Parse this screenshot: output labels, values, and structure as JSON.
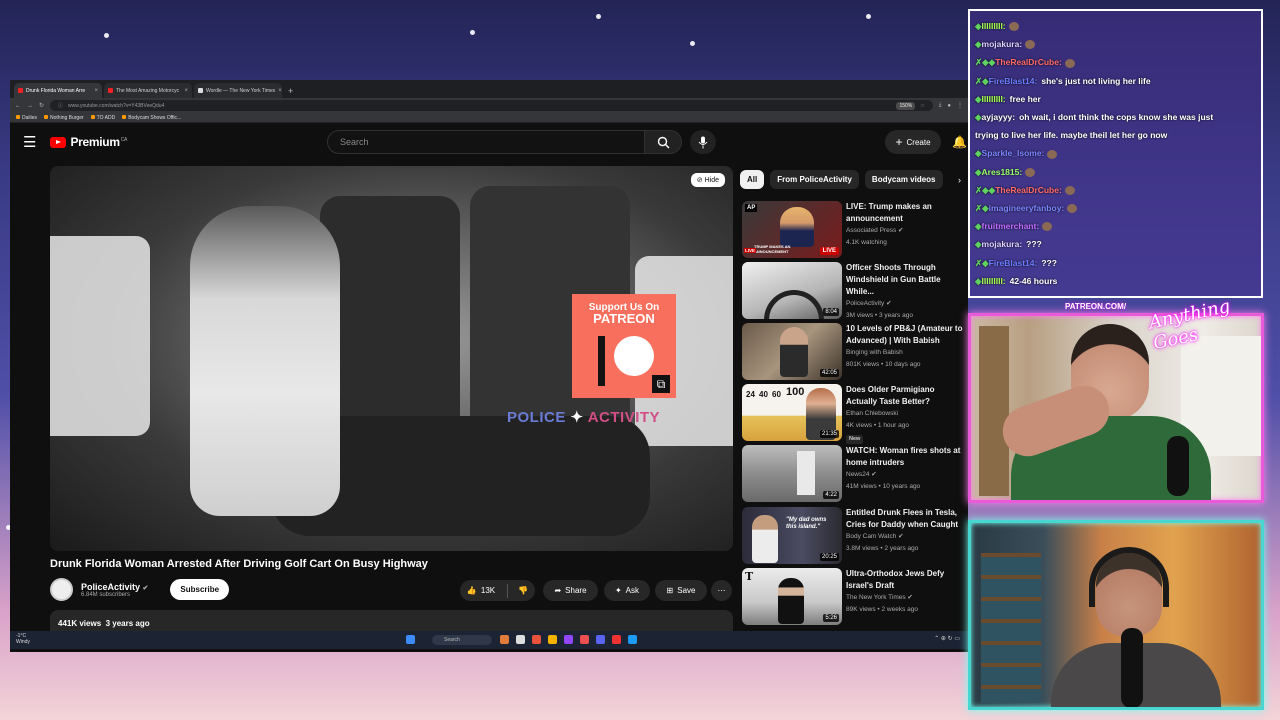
{
  "browser": {
    "tabs": [
      {
        "label": "Drunk Florida Woman Arre",
        "active": true
      },
      {
        "label": "The Most Amazing Motorcyc",
        "active": false
      },
      {
        "label": "Wordle — The New York Times",
        "active": false
      }
    ],
    "url": "www.youtube.com/watch?v=Y43BVeeQdu4",
    "zoom": "150%",
    "bookmarks": [
      "Dailies",
      "Nothing Burger",
      "TO ADD",
      "Bodycam Shows Offic..."
    ]
  },
  "youtube": {
    "logo": "Premium",
    "region": "CA",
    "search_placeholder": "Search",
    "create_label": "Create",
    "hide_label": "Hide",
    "video_title": "Drunk Florida Woman Arrested After Driving Golf Cart On Busy Highway",
    "channel": {
      "name": "PoliceActivity",
      "subs": "6.84M subscribers"
    },
    "subscribe_label": "Subscribe",
    "likes": "13K",
    "share_label": "Share",
    "ask_label": "Ask",
    "save_label": "Save",
    "views_line": "441K views  3 years ago",
    "overlay": {
      "support": "Support Us On",
      "patreon": "PATREON",
      "brand_left": "POLICE",
      "brand_right": "ACTIVITY"
    }
  },
  "chips": [
    "All",
    "From PoliceActivity",
    "Bodycam videos"
  ],
  "recommendations": [
    {
      "title": "LIVE: Trump makes an announcement",
      "channel": "Associated Press",
      "meta": "4.1K watching",
      "badge": "LIVE",
      "thumb_text": "TRUMP MAKES AN ANNOUNCEMENT",
      "corner": "AP",
      "thumb_color": "#7a1b1b"
    },
    {
      "title": "Officer Shoots Through Windshield in Gun Battle While...",
      "channel": "PoliceActivity",
      "meta": "3M views • 3 years ago",
      "duration": "8:04",
      "thumb_color": "#d8d8d8"
    },
    {
      "title": "10 Levels of PB&J (Amateur to Advanced) | With Babish",
      "channel": "Binging with Babish",
      "meta": "801K views • 10 days ago",
      "duration": "42:05",
      "thumb_color": "#8a7560"
    },
    {
      "title": "Does Older Parmigiano Actually Taste Better?",
      "channel": "Ethan Chlebowski",
      "meta": "4K views • 1 hour ago",
      "duration": "21:35",
      "new": "New",
      "thumb_numbers": [
        "24",
        "40",
        "60",
        "100"
      ],
      "thumb_color": "#f1d889"
    },
    {
      "title": "WATCH: Woman fires shots at home intruders",
      "channel": "News24",
      "meta": "41M views • 10 years ago",
      "duration": "4:22",
      "thumb_color": "#8d8d8d"
    },
    {
      "title": "Entitled Drunk Flees in Tesla, Cries for Daddy when Caught",
      "channel": "Body Cam Watch",
      "meta": "3.8M views • 2 years ago",
      "duration": "20:25",
      "thumb_text": "\"My dad owns this island.\"",
      "thumb_color": "#33333f"
    },
    {
      "title": "Ultra-Orthodox Jews Defy Israel's Draft",
      "channel": "The New York Times",
      "meta": "89K views • 2 weeks ago",
      "duration": "5:26",
      "corner": "T",
      "thumb_color": "#d4d4d4"
    }
  ],
  "taskbar": {
    "weather": "-1°C",
    "weather_sub": "Windy",
    "search": "Search"
  },
  "chat": [
    {
      "user": "IIIIIIIII:",
      "text": "",
      "color": "#a6ff4d",
      "badges": "◆"
    },
    {
      "user": "mojakura:",
      "text": "",
      "color": "#dcd0ff",
      "badges": "◆"
    },
    {
      "user": "TheRealDrCube:",
      "text": "",
      "color": "#ff6a6a",
      "badges": "✗◆◆"
    },
    {
      "user": "FireBlast14:",
      "text": "she's just not living her life",
      "color": "#6a7dff",
      "badges": "✗◆"
    },
    {
      "user": "IIIIIIIII:",
      "text": "free her",
      "color": "#a6ff4d",
      "badges": "◆"
    },
    {
      "user": "ayjayyy:",
      "text": "oh wait, i dont think the cops know she was just",
      "color": "#ffffff",
      "badges": "◆"
    },
    {
      "user": "",
      "text": "trying to live her life. maybe theil let her go now",
      "color": "#ffffff",
      "badges": ""
    },
    {
      "user": "Sparkle_Isome:",
      "text": "",
      "color": "#7a86ff",
      "badges": "◆"
    },
    {
      "user": "Ares1815:",
      "text": "",
      "color": "#9bff6a",
      "badges": "◆"
    },
    {
      "user": "TheRealDrCube:",
      "text": "",
      "color": "#ff6a6a",
      "badges": "✗◆◆"
    },
    {
      "user": "imagineeryfanboy:",
      "text": "",
      "color": "#7a86ff",
      "badges": "✗◆"
    },
    {
      "user": "fruitmerchant:",
      "text": "",
      "color": "#c06bff",
      "badges": "◆"
    },
    {
      "user": "mojakura:",
      "text": "???",
      "color": "#dcd0ff",
      "badges": "◆"
    },
    {
      "user": "FireBlast14:",
      "text": "???",
      "color": "#6a7dff",
      "badges": "✗◆"
    },
    {
      "user": "IIIIIIIII:",
      "text": "42-46 hours",
      "color": "#a6ff4d",
      "badges": "◆"
    }
  ],
  "overlay": {
    "patreon_label": "PATREON.COM/",
    "script": "Anything Goes"
  },
  "colors": {
    "yt_red": "#ff0000",
    "patreon": "#f86f5d",
    "cam1_frame": "#e85ad8",
    "cam2_frame": "#47d6d0"
  }
}
